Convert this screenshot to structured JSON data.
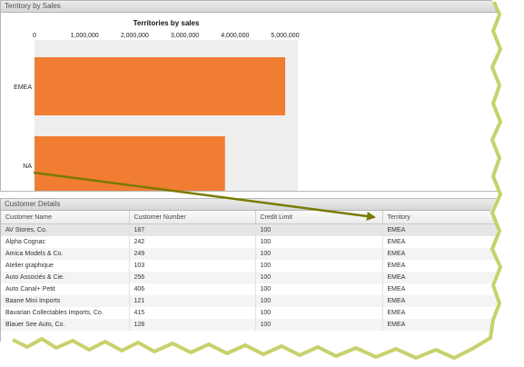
{
  "sales_panel": {
    "title": "Territory by Sales"
  },
  "chart_data": {
    "type": "bar",
    "orientation": "horizontal",
    "title": "Territories by sales",
    "xlabel": "",
    "ylabel": "",
    "xlim": [
      0,
      5000000
    ],
    "x_ticks": [
      "0",
      "1,000,000",
      "2,000,000",
      "3,000,000",
      "4,000,000",
      "5,000,000"
    ],
    "categories": [
      "EMEA",
      "NA"
    ],
    "values": [
      5000000,
      3800000
    ],
    "bar_color": "#f07d32",
    "grid": false
  },
  "customer_panel": {
    "title": "Customer Details",
    "columns": [
      "Customer Name",
      "Customer Number",
      "Credit Limit",
      "Territory"
    ],
    "rows": [
      [
        "AV Stores, Co.",
        "187",
        "100",
        "EMEA"
      ],
      [
        "Alpha Cognac",
        "242",
        "100",
        "EMEA"
      ],
      [
        "Amica Models & Co.",
        "249",
        "100",
        "EMEA"
      ],
      [
        "Atelier graphique",
        "103",
        "100",
        "EMEA"
      ],
      [
        "Auto Associés & Cie.",
        "256",
        "100",
        "EMEA"
      ],
      [
        "Auto Canal+ Petit",
        "406",
        "100",
        "EMEA"
      ],
      [
        "Baane Mini Imports",
        "121",
        "100",
        "EMEA"
      ],
      [
        "Bavarian Collectables Imports, Co.",
        "415",
        "100",
        "EMEA"
      ],
      [
        "Blauer See Auto, Co.",
        "128",
        "100",
        "EMEA"
      ]
    ]
  },
  "colors": {
    "annotation_arrow": "#7a7a00",
    "torn_edge_shadow": "#b5c23a"
  }
}
